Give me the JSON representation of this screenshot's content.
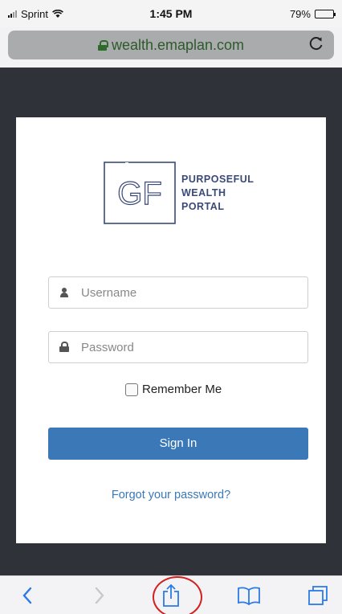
{
  "status_bar": {
    "carrier": "Sprint",
    "time": "1:45 PM",
    "battery": "79%",
    "battery_level": 0.79
  },
  "browser": {
    "url": "wealth.emaplan.com",
    "icons": {
      "lock": "lock-icon",
      "reload": "reload-icon"
    }
  },
  "login": {
    "logo": {
      "monogram": "GF",
      "lines": [
        "PURPOSEFUL",
        "WEALTH",
        "PORTAL"
      ],
      "color": "#3a4a78"
    },
    "username_placeholder": "Username",
    "password_placeholder": "Password",
    "remember_label": "Remember Me",
    "remember_checked": false,
    "signin_label": "Sign In",
    "forgot_label": "Forgot your password?",
    "accent_color": "#3a78b8"
  },
  "toolbar": {
    "items": [
      "back-icon",
      "forward-icon",
      "share-icon",
      "bookmarks-icon",
      "tabs-icon"
    ],
    "highlight_color": "#d21f1f"
  }
}
